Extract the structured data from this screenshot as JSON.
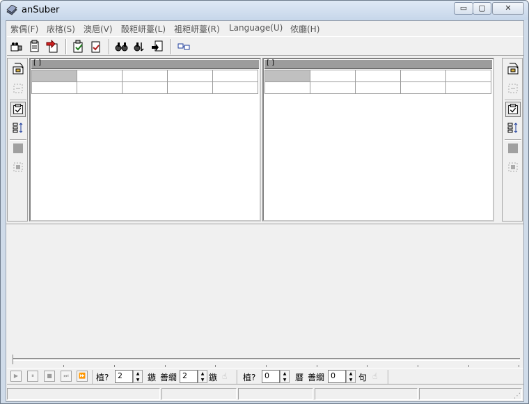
{
  "window": {
    "title": "anSuber",
    "buttons": {
      "minimize": "▭",
      "maximize": "▢",
      "close": "✕"
    }
  },
  "menu": [
    {
      "label": "紫偶(F)"
    },
    {
      "label": "庡楁(S)"
    },
    {
      "label": "澳巵(V)"
    },
    {
      "label": "酘粔岍薹(L)"
    },
    {
      "label": "袓粔岍薹(R)"
    },
    {
      "label": "Language(U)"
    },
    {
      "label": "侬廳(H)"
    }
  ],
  "toolbar": {
    "icons": [
      "open-video-icon",
      "open-subtitle-icon",
      "import-icon",
      "save-icon",
      "save-as-icon",
      "find-icon",
      "find-next-icon",
      "replace-icon",
      "sync-icon"
    ]
  },
  "left_panel": {
    "header": "[ ]"
  },
  "right_panel": {
    "header": "[ ]"
  },
  "side_icons": [
    "open-file-icon",
    "filter-icon",
    "edit-icon",
    "sort-icon",
    "stop-icon",
    "select-icon"
  ],
  "controls": {
    "play_buttons": [
      "▶",
      "⏸",
      "■",
      "⏭",
      "⏩"
    ],
    "label1": "植?",
    "spin1": "2",
    "label2": "鏃",
    "label3": "善繝",
    "spin2": "2",
    "label4": "鏃",
    "label5": "植?",
    "spin3": "0",
    "label6": "曆",
    "label7": "善繝",
    "spin4": "0",
    "label8": "句"
  },
  "colors": {
    "accent": "#316ac5",
    "panel_header": "#9c9c9c",
    "window_bg": "#f0f0f0"
  }
}
